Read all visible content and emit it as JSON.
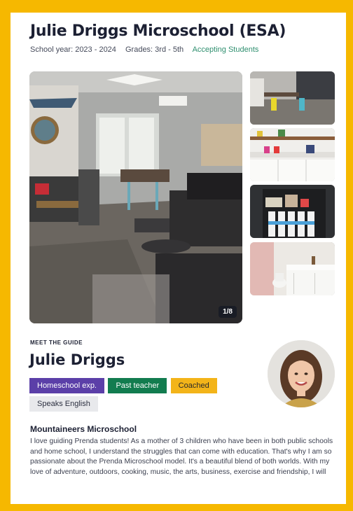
{
  "page": {
    "title": "Julie Driggs Microschool (ESA)",
    "school_year": "School year: 2023 - 2024",
    "grades": "Grades: 3rd - 5th",
    "status": "Accepting Students"
  },
  "gallery": {
    "counter": "1/8",
    "thumbnails": [
      "classroom-photo",
      "kitchen-shelf-photo",
      "supply-shelf-photo",
      "bathroom-photo"
    ]
  },
  "guide": {
    "eyebrow": "MEET THE GUIDE",
    "name": "Julie Driggs",
    "tags": [
      {
        "label": "Homeschool exp."
      },
      {
        "label": "Past teacher"
      },
      {
        "label": "Coached"
      },
      {
        "label": "Speaks English"
      }
    ]
  },
  "school": {
    "heading": "Mountaineers Microschool",
    "bio": "I love guiding Prenda students! As a mother of 3 children who have been in both public schools and home school, I understand the struggles that can come with education. That's why I am so passionate about the Prenda Microschool model. It's a beautiful blend of both worlds. With my love of adventure, outdoors, cooking, music, the arts, business, exercise and friendship, I will"
  },
  "colors": {
    "frame": "#f6b800",
    "accent_green": "#2f8f6f",
    "tag_purple": "#5b3fa8",
    "tag_green": "#127c4f",
    "tag_amber": "#f3b419"
  }
}
